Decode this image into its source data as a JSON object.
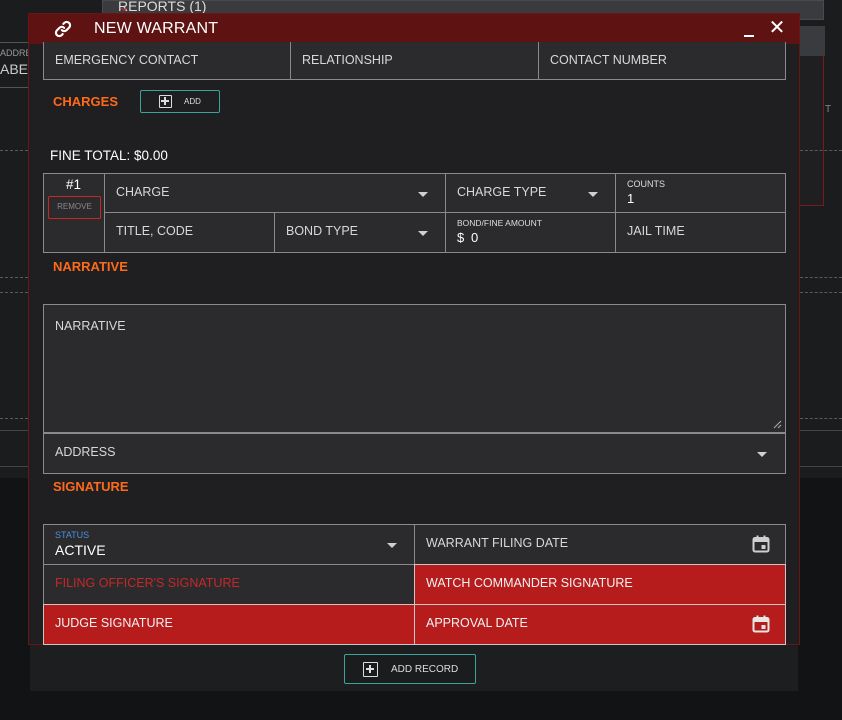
{
  "background": {
    "reports_label": "REPORTS (1)",
    "left_field_label": "ADDRE",
    "left_field_value": "ABE",
    "right_fragment": "T"
  },
  "modal": {
    "title": "NEW WARRANT",
    "close_glyph": "✕"
  },
  "contact_row": {
    "emergency_contact": "EMERGENCY CONTACT",
    "relationship": "RELATIONSHIP",
    "contact_number": "CONTACT NUMBER"
  },
  "charges": {
    "section_title": "CHARGES",
    "add_label": "ADD",
    "fine_total_label": "FINE TOTAL:",
    "fine_total_value": "$0.00",
    "item": {
      "number": "#1",
      "remove_label": "REMOVE",
      "charge": "CHARGE",
      "charge_type": "CHARGE TYPE",
      "counts_label": "COUNTS",
      "counts_value": "1",
      "title_code": "TITLE, CODE",
      "bond_type": "BOND TYPE",
      "bond_amount_label": "BOND/FINE AMOUNT",
      "bond_amount_prefix": "$",
      "bond_amount_value": "0",
      "jail_time": "JAIL TIME"
    }
  },
  "narrative": {
    "section_title": "NARRATIVE",
    "textarea_label": "NARRATIVE",
    "address_label": "ADDRESS"
  },
  "signature": {
    "section_title": "SIGNATURE",
    "status_label": "STATUS",
    "status_value": "ACTIVE",
    "warrant_filing_date": "WARRANT FILING DATE",
    "filing_officer_signature": "FILING OFFICER'S SIGNATURE",
    "watch_commander_signature": "WATCH COMMANDER SIGNATURE",
    "judge_signature": "JUDGE SIGNATURE",
    "approval_date": "APPROVAL DATE"
  },
  "footer": {
    "add_record_label": "ADD RECORD"
  },
  "colors": {
    "accent_orange": "#ff6a1a",
    "signature_red": "#b71c1c",
    "titlebar": "#5e1212",
    "teal_button": "#3aa39a",
    "status_label_blue": "#4a90e2"
  }
}
